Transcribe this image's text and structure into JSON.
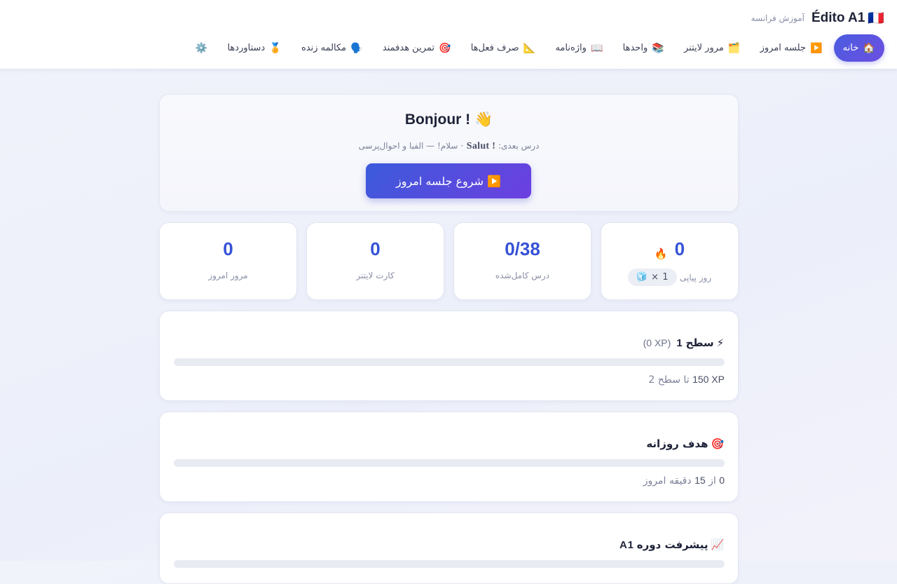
{
  "header": {
    "brand": "Édito A1",
    "brand_flag": "🇫🇷",
    "subtitle": "آموزش فرانسه",
    "nav": [
      {
        "icon": "🏠",
        "label": "خانه",
        "active": true
      },
      {
        "icon": "▶️",
        "label": "جلسه امروز"
      },
      {
        "icon": "🗂️",
        "label": "مرور لایتنر"
      },
      {
        "icon": "📚",
        "label": "واحدها"
      },
      {
        "icon": "📖",
        "label": "واژه‌نامه"
      },
      {
        "icon": "📐",
        "label": "صرف فعل‌ها"
      },
      {
        "icon": "🎯",
        "label": "تمرین هدفمند"
      },
      {
        "icon": "🗣️",
        "label": "مکالمه زنده"
      },
      {
        "icon": "🏅",
        "label": "دستاوردها"
      },
      {
        "icon": "⚙️",
        "label": ""
      }
    ]
  },
  "hero": {
    "title": "Bonjour ! 👋",
    "next_prefix": "درس بعدی:",
    "next_lesson": "Salut !",
    "next_suffix": "· سلام! — الفبا و احوال‌پرسی",
    "cta_icon": "▶️",
    "cta_label": "شروع جلسه امروز"
  },
  "stats": {
    "streak": {
      "value": "0",
      "icon": "🔥",
      "label": "روز پیاپی",
      "freeze": "🧊 × 1"
    },
    "lessons": {
      "value": "0/38",
      "label": "درس کامل‌شده"
    },
    "cards": {
      "value": "0",
      "label": "کارت لایتنر"
    },
    "reviews": {
      "value": "0",
      "label": "مرور امروز"
    }
  },
  "level": {
    "icon": "⚡",
    "title_prefix": "سطح",
    "level_num": "1",
    "xp": "(0 XP)",
    "progress": 0,
    "foot_xp": "150 XP",
    "foot_text": "تا سطح 2"
  },
  "daily_goal": {
    "icon": "🎯",
    "title": "هدف روزانه",
    "progress": 0,
    "foot_done": "0",
    "foot_mid": "از",
    "foot_total": "15",
    "foot_end": "دقیقه امروز"
  },
  "course_progress": {
    "icon": "📈",
    "title": "پیشرفت دوره",
    "level_code": "A1"
  },
  "colors": {
    "accent": "#3552d6",
    "accent_gradient_end": "#6d3fe0",
    "track": "#e9ebf3"
  }
}
